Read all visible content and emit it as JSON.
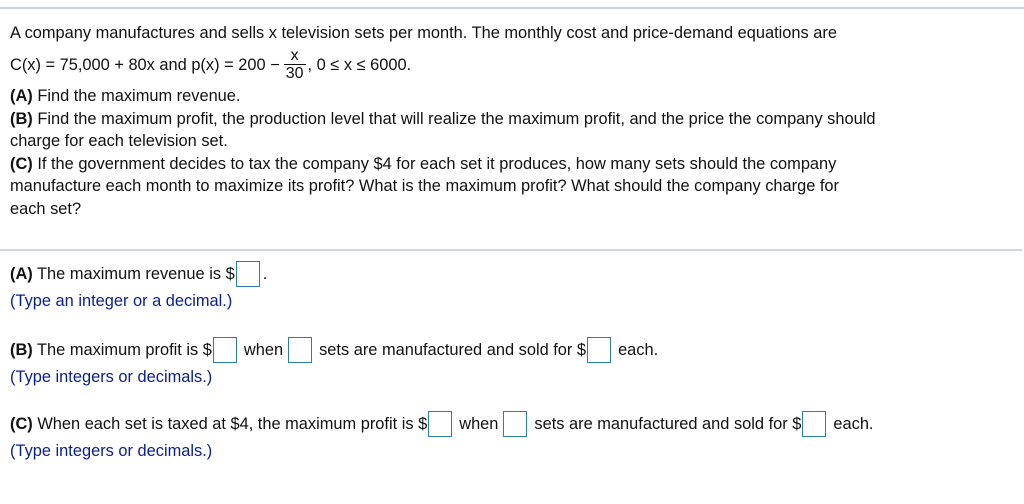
{
  "question": {
    "intro": "A company manufactures and sells x television sets per month. The monthly cost and price-demand equations are",
    "equation_prefix": "C(x) = 75,000 + 80x and p(x) = 200 −",
    "fraction_numerator": "x",
    "fraction_denominator": "30",
    "equation_suffix": ", 0 ≤ x ≤ 6000.",
    "parts": [
      {
        "label": "(A)",
        "text": " Find the maximum revenue."
      },
      {
        "label": "(B)",
        "text_line1": " Find the maximum profit, the production level that will realize the maximum profit, and the price the company should",
        "text_line2": "charge for each television set."
      },
      {
        "label": "(C)",
        "text_line1": " If the government decides to tax the company $4 for each set it produces, how many sets should the company",
        "text_line2": "manufacture each month to maximize its profit? What is the maximum profit? What should the company charge for",
        "text_line3": "each set?"
      }
    ]
  },
  "answers": {
    "a": {
      "label": "(A)",
      "text_before": " The maximum revenue is $",
      "text_after": ".",
      "revenue_value": "",
      "hint": "(Type an integer or a decimal.)"
    },
    "b": {
      "label": "(B)",
      "text1": " The maximum profit is $",
      "text2": "when",
      "text3": "sets are manufactured and sold for $",
      "text4": "each.",
      "profit_value": "",
      "sets_value": "",
      "price_value": "",
      "hint": "(Type integers or decimals.)"
    },
    "c": {
      "label": "(C)",
      "text1": " When each set is taxed at $4, the maximum profit is $",
      "text2": "when",
      "text3": "sets are manufactured and sold for $",
      "text4": "each.",
      "profit_value": "",
      "sets_value": "",
      "price_value": "",
      "hint": "(Type integers or decimals.)"
    }
  },
  "colors": {
    "hint_text": "#0b1f8c",
    "input_border": "#2a7fa8",
    "divider": "#cfd5e2"
  }
}
